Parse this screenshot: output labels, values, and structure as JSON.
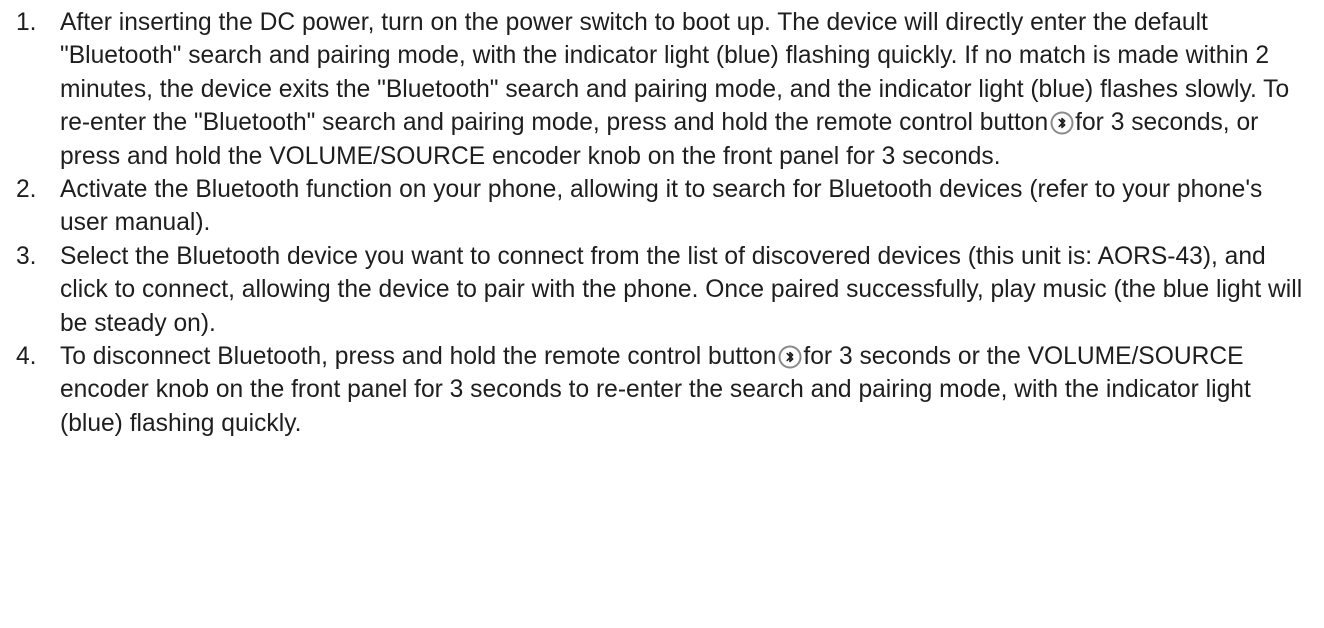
{
  "steps": [
    {
      "num": "1.",
      "before_icon_1": "After inserting the DC power, turn on the power switch to boot up. The device will directly enter the default \"Bluetooth\" search and pairing mode, with the indicator light (blue) flashing quickly. If no match is made within 2 minutes, the device exits the \"Bluetooth\" search and pairing mode, and the indicator light (blue) flashes slowly. To re-enter the \"Bluetooth\" search and pairing mode, press and hold the remote control button",
      "after_icon_1": "for 3 seconds, or press and hold the VOLUME/SOURCE encoder knob on the front panel for 3 seconds."
    },
    {
      "num": "2.",
      "text": "Activate the Bluetooth function on your phone, allowing it to search for Bluetooth devices (refer to your phone's user manual)."
    },
    {
      "num": "3.",
      "text": "Select the Bluetooth device you want to connect from the list of discovered devices (this unit is: AORS-43), and click to connect, allowing the device to pair with the phone. Once paired successfully, play music (the blue light will be steady on)."
    },
    {
      "num": "4.",
      "before_icon_1": "To disconnect Bluetooth, press and hold the remote control button",
      "after_icon_1": "for 3 seconds or the VOLUME/SOURCE encoder knob on the front panel for 3 seconds to re-enter the search and pairing mode, with the indicator light (blue) flashing quickly."
    }
  ],
  "icons": {
    "remote_button": "bluetooth-remote-button-icon",
    "colors": {
      "ring": "#8a8a8a",
      "fill": "#ffffff",
      "glyph": "#1e1e1e"
    }
  }
}
